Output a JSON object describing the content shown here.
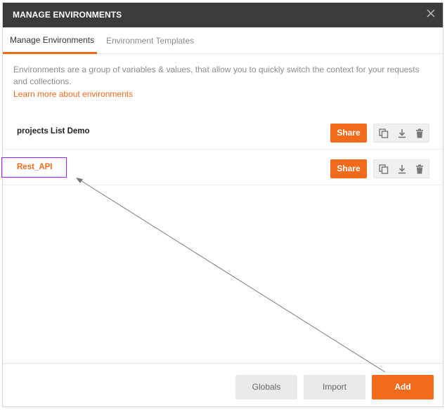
{
  "dialog": {
    "title": "MANAGE ENVIRONMENTS",
    "close_icon": "close-icon"
  },
  "tabs": [
    {
      "label": "Manage Environments",
      "active": true
    },
    {
      "label": "Environment Templates",
      "active": false
    }
  ],
  "description": "Environments are a group of variables & values, that allow you to quickly switch the context for your requests and collections.",
  "learn_more": "Learn more about environments",
  "environments": [
    {
      "name": "projects List Demo",
      "share_label": "Share",
      "icons": [
        "duplicate-icon",
        "download-icon",
        "delete-icon"
      ]
    },
    {
      "name": "Rest_API",
      "share_label": "Share",
      "icons": [
        "duplicate-icon",
        "download-icon",
        "delete-icon"
      ]
    }
  ],
  "footer": {
    "globals_label": "Globals",
    "import_label": "Import",
    "add_label": "Add"
  },
  "colors": {
    "accent": "#f26b1d",
    "titlebar": "#3b3b3b",
    "highlight_box": "#a020f0"
  }
}
